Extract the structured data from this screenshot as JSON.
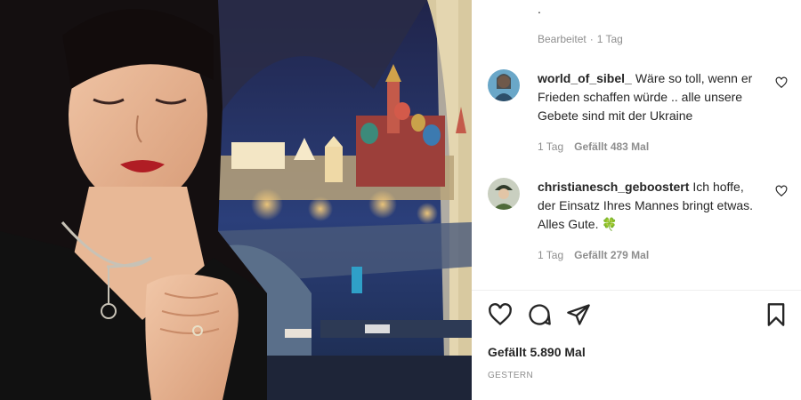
{
  "post": {
    "caption_end": ".",
    "edited_label": "Bearbeitet",
    "separator": "·",
    "edited_age": "1 Tag",
    "likes_total": "Gefällt 5.890 Mal",
    "date": "GESTERN"
  },
  "comments": [
    {
      "username": "world_of_sibel_",
      "text": "Wäre so toll, wenn er Frieden schaffen würde .. alle unsere Gebete sind mit der Ukraine",
      "age": "1 Tag",
      "likes": "Gefällt 483 Mal"
    },
    {
      "username": "christianesch_geboostert",
      "text": "Ich hoffe, der Einsatz Ihres Mannes bringt etwas. Alles Gute.",
      "emoji": "🍀",
      "age": "1 Tag",
      "likes": "Gefällt 279 Mal"
    }
  ],
  "icons": {
    "comment_like": "heart-outline-icon",
    "like": "heart-outline-icon",
    "comment": "speech-bubble-icon",
    "share": "paper-plane-icon",
    "save": "bookmark-icon"
  },
  "colors": {
    "text": "#262626",
    "secondary": "#8e8e8e",
    "divider": "#efefef",
    "background": "#ffffff"
  }
}
